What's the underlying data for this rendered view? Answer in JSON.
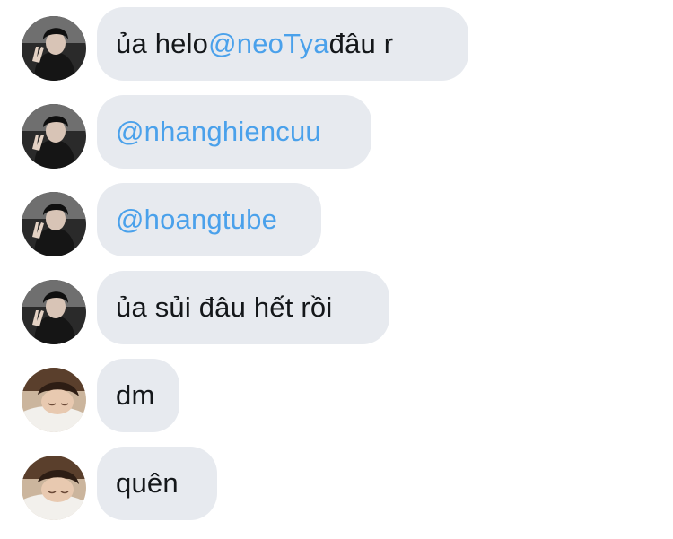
{
  "conversation": {
    "messages": [
      {
        "sender_avatar": "dark-hoodie-avatar",
        "parts": [
          {
            "text": "ủa helo ",
            "type": "text"
          },
          {
            "text": "@neoTya",
            "type": "mention"
          },
          {
            "text": " đâu r",
            "type": "text"
          }
        ]
      },
      {
        "sender_avatar": "dark-hoodie-avatar",
        "parts": [
          {
            "text": "@nhanghiencuu",
            "type": "mention"
          }
        ]
      },
      {
        "sender_avatar": "dark-hoodie-avatar",
        "parts": [
          {
            "text": "@hoangtube",
            "type": "mention"
          }
        ]
      },
      {
        "sender_avatar": "dark-hoodie-avatar",
        "parts": [
          {
            "text": "ủa sủi đâu hết rồi",
            "type": "text"
          }
        ]
      },
      {
        "sender_avatar": "pillow-avatar",
        "parts": [
          {
            "text": "dm",
            "type": "text"
          }
        ]
      },
      {
        "sender_avatar": "pillow-avatar",
        "parts": [
          {
            "text": "quên",
            "type": "text"
          }
        ]
      }
    ]
  },
  "colors": {
    "bubble_bg": "#e7eaef",
    "text": "#14171a",
    "mention": "#4aa1eb",
    "background": "#ffffff"
  }
}
